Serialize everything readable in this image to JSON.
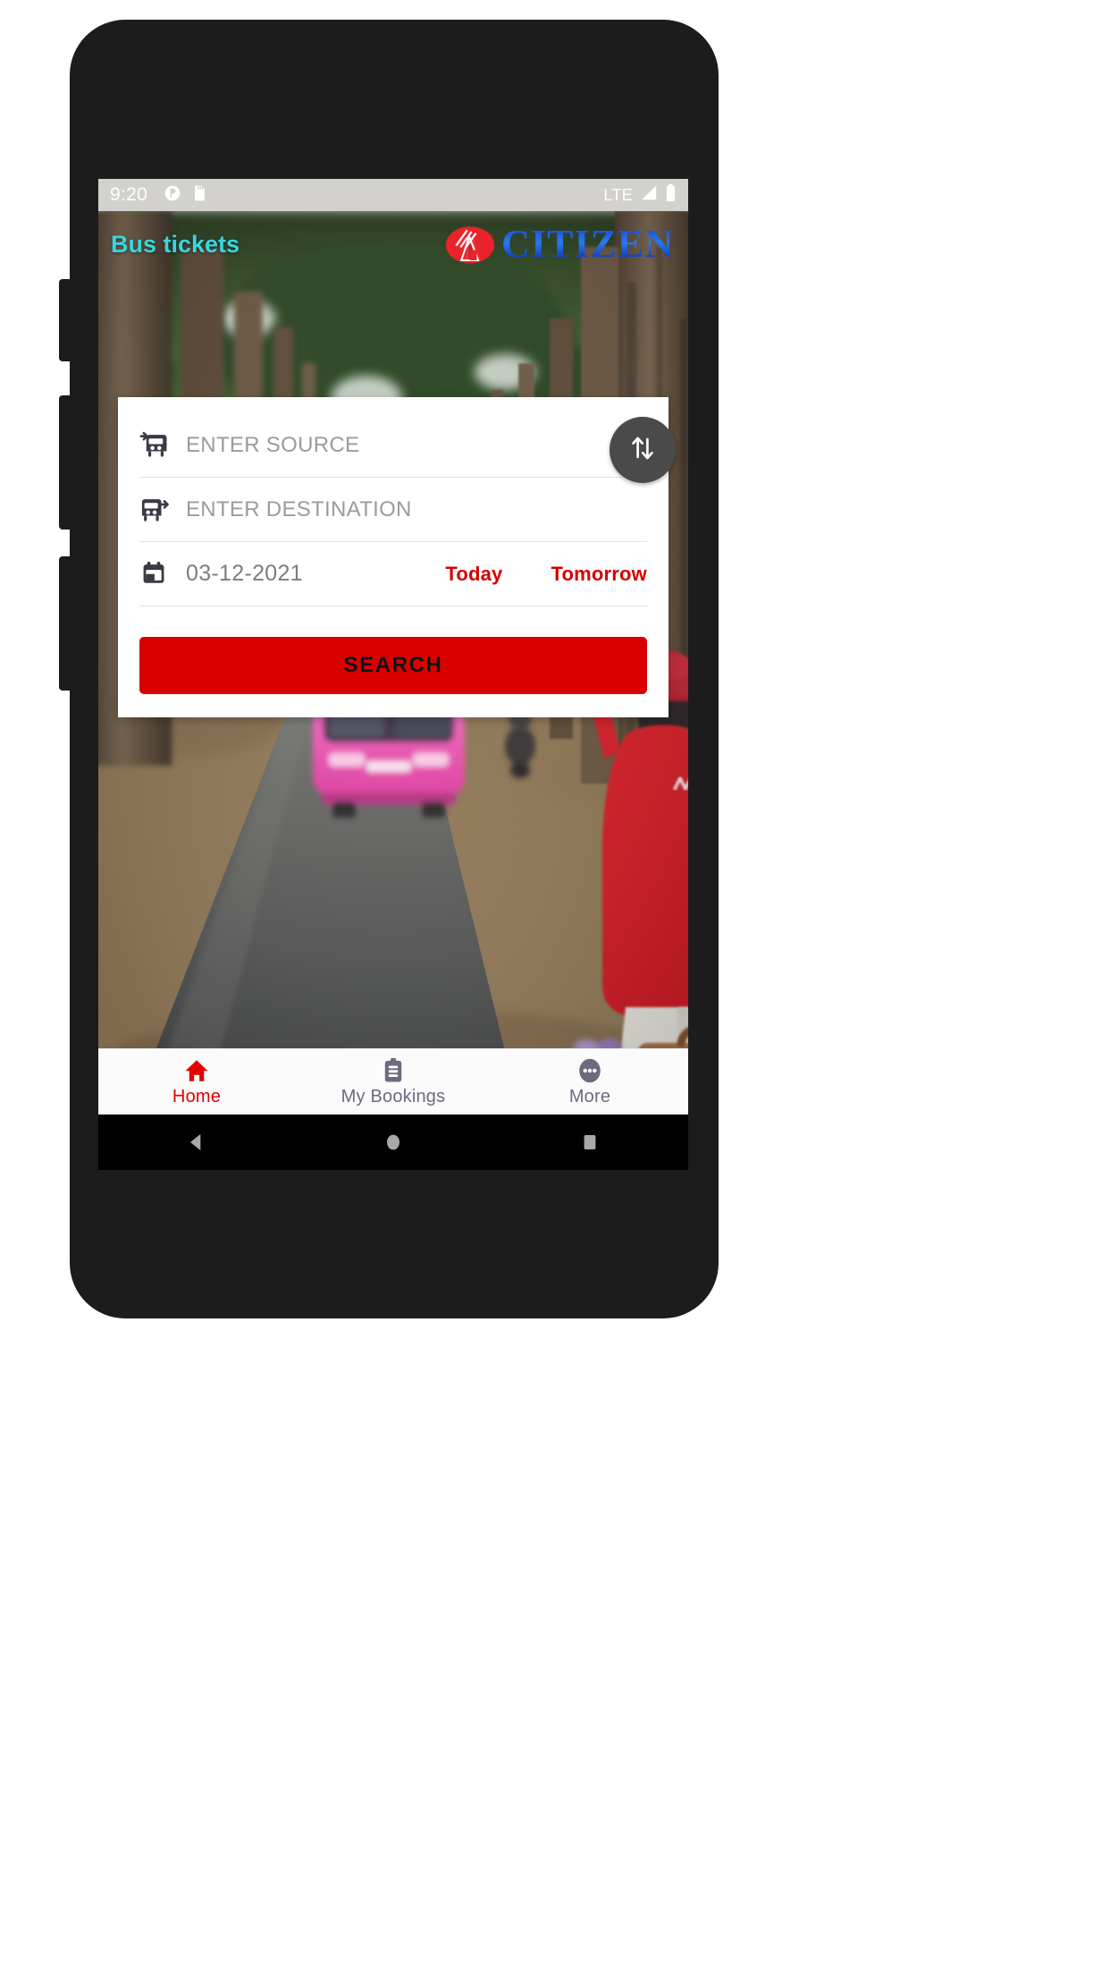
{
  "status_bar": {
    "time": "9:20",
    "left_icons": [
      "do-not-disturb-icon",
      "sd-card-icon"
    ],
    "network_label": "LTE",
    "right_icons": [
      "signal-strength-icon",
      "battery-icon"
    ]
  },
  "header": {
    "title": "Bus tickets",
    "title_color": "#38d6dd",
    "brand_name": "CITIZEN",
    "brand_mark": "citizen-logo-icon"
  },
  "search_card": {
    "source": {
      "icon": "bus-arrival-icon",
      "placeholder": "ENTER SOURCE",
      "value": ""
    },
    "destination": {
      "icon": "bus-departure-icon",
      "placeholder": "ENTER DESTINATION",
      "value": ""
    },
    "date": {
      "icon": "calendar-icon",
      "value": "03-12-2021",
      "quick_options": [
        "Today",
        "Tomorrow"
      ],
      "quick_option_color": "#d50000"
    },
    "swap_button": {
      "icon": "swap-vertical-icon",
      "background": "#4a4a4a"
    },
    "search_button": {
      "label": "SEARCH",
      "background": "#d90000",
      "text_color": "#111111"
    }
  },
  "bottom_nav": {
    "items": [
      {
        "label": "Home",
        "icon": "home-icon",
        "active": true,
        "color": "#e10000"
      },
      {
        "label": "My Bookings",
        "icon": "clipboard-icon",
        "active": false,
        "color": "#6b6b80"
      },
      {
        "label": "More",
        "icon": "ellipsis-circle-icon",
        "active": false,
        "color": "#6b6b80"
      }
    ]
  },
  "android_nav": {
    "buttons": [
      "back-button",
      "home-button",
      "recents-button"
    ]
  },
  "background": {
    "description": "woman-hailing-bus-photo",
    "road_color": "#5d5e5c",
    "bus_color": "#f06ec0",
    "jacket_color": "#d81f26"
  }
}
